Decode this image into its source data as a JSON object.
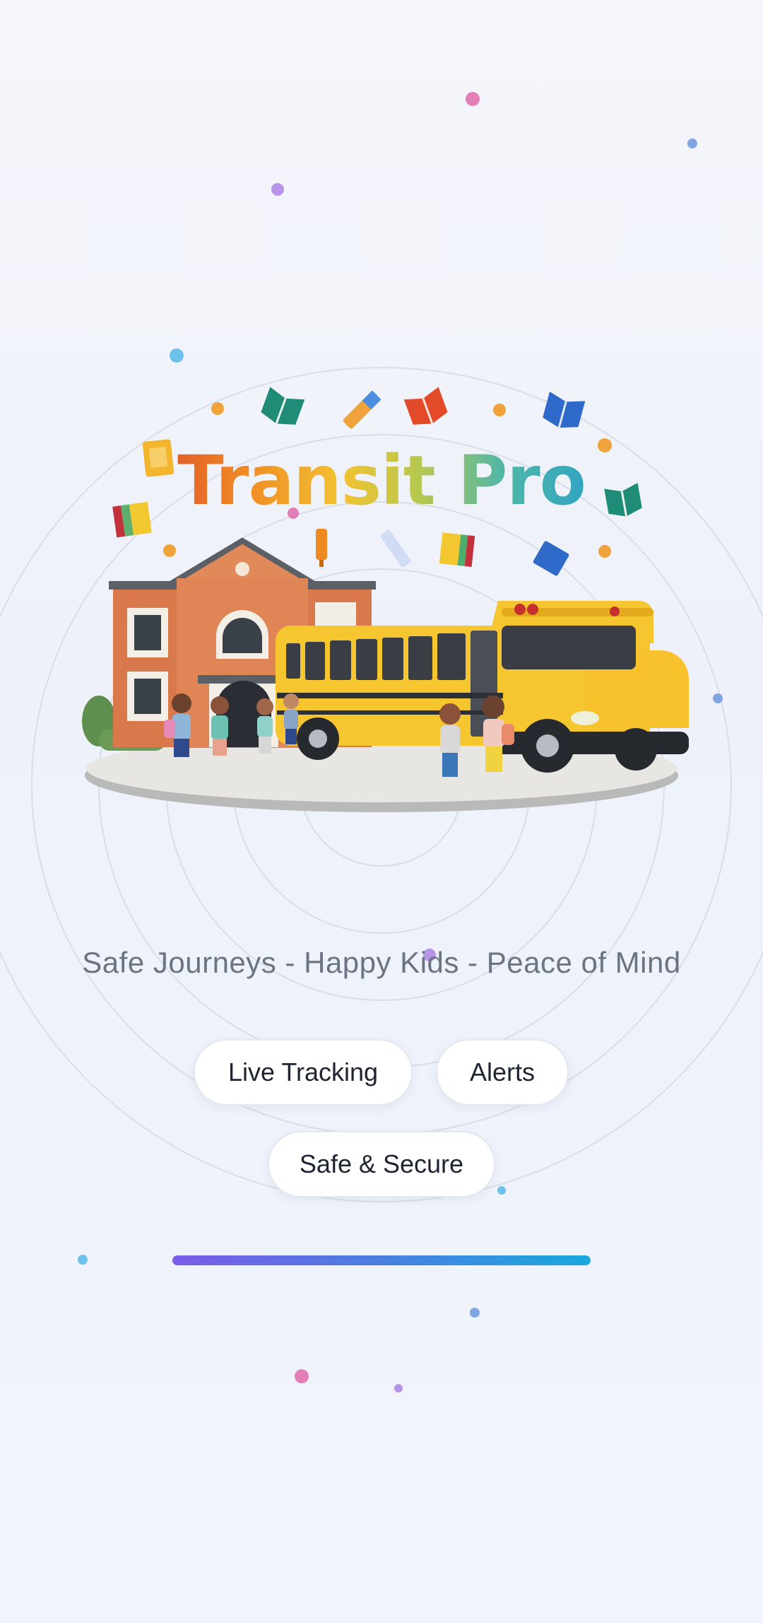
{
  "app": {
    "title": "Transit Pro",
    "tagline": "Safe Journeys - Happy Kids - Peace of Mind"
  },
  "hero": {
    "illustration": "school-building-and-school-bus-with-children",
    "decorations": [
      "book-icon",
      "pencil-icon",
      "star-icon",
      "ruler-icon"
    ]
  },
  "features": [
    {
      "label": "Live Tracking"
    },
    {
      "label": "Alerts"
    },
    {
      "label": "Safe & Secure"
    }
  ],
  "loading": {
    "progress": 1.0
  },
  "colors": {
    "background": "#f2f4fb",
    "tagline": "#6b7482",
    "chip_text": "#1f2433",
    "progress_start": "#7b5ce8",
    "progress_end": "#1aa8de",
    "bus_yellow": "#f6c631",
    "school_brick": "#d9784a"
  }
}
